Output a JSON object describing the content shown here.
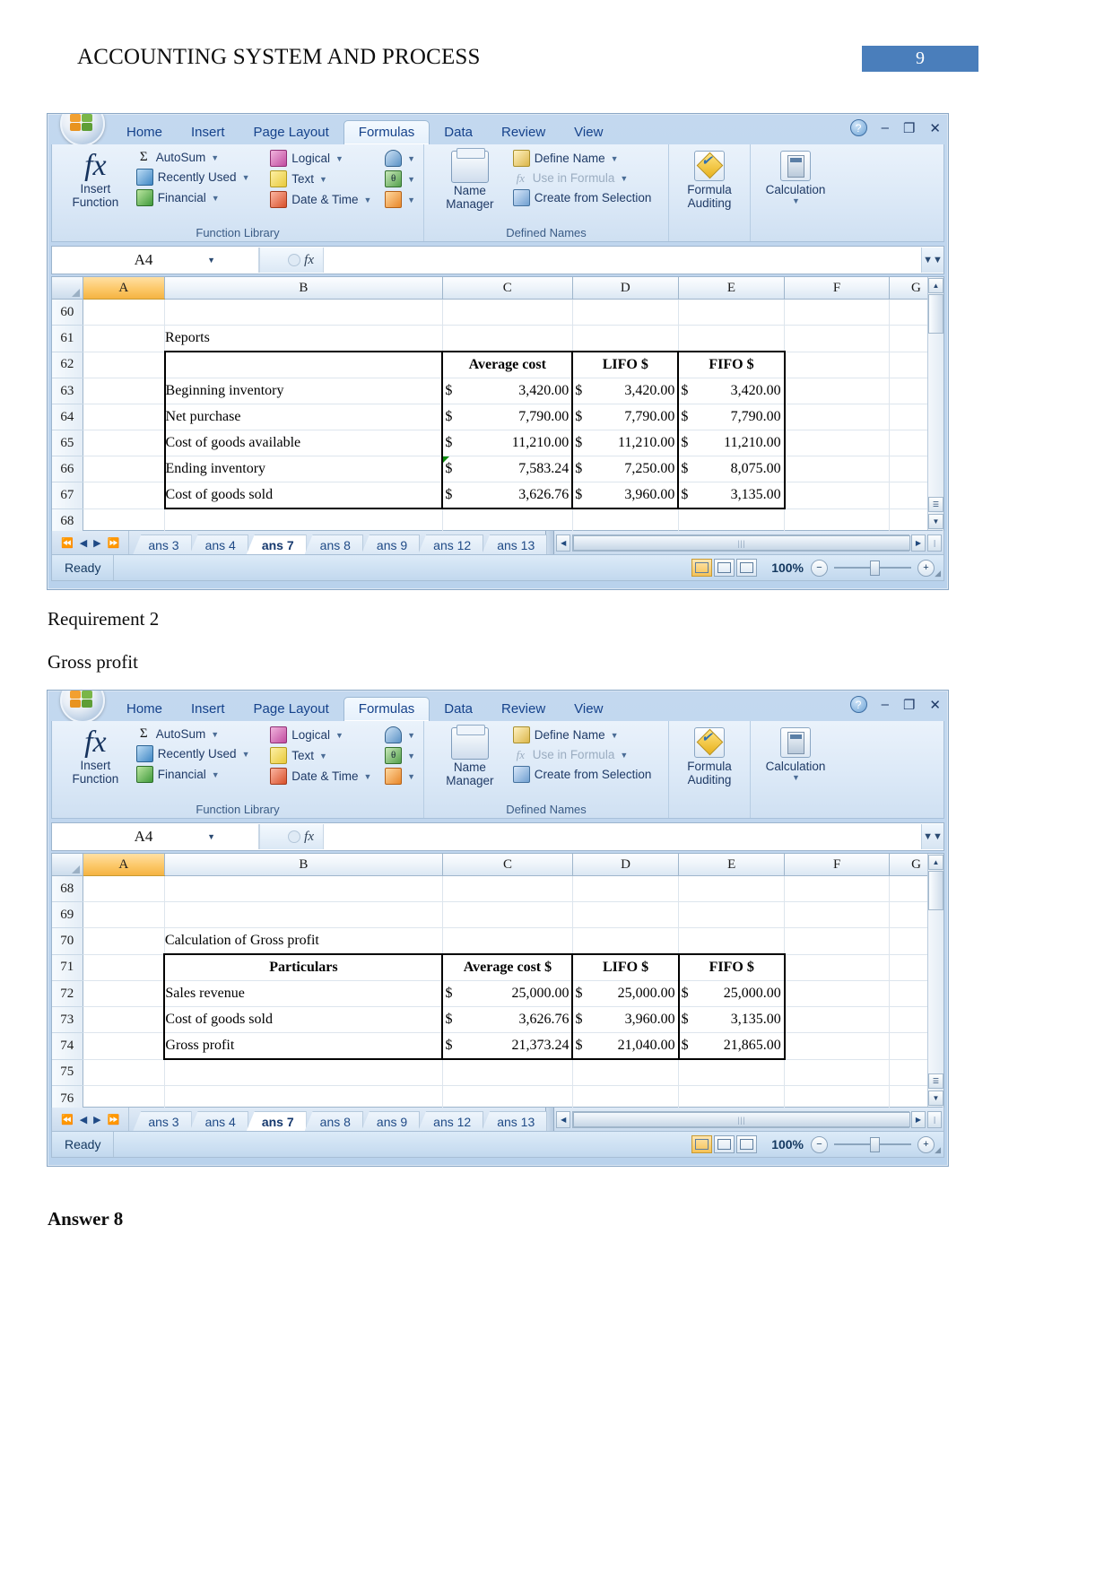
{
  "header": {
    "title": "ACCOUNTING SYSTEM AND PROCESS",
    "page_number": "9",
    "accent_color": "#4a7ebb"
  },
  "body_text": {
    "requirement_2": "Requirement 2",
    "gross_profit": "Gross profit",
    "answer_8": "Answer 8"
  },
  "excel": {
    "ribbon_tabs": [
      "Home",
      "Insert",
      "Page Layout",
      "Formulas",
      "Data",
      "Review",
      "View"
    ],
    "active_ribbon_tab": "Formulas",
    "window_controls": {
      "help": "?",
      "minimize": "–",
      "restore": "❐",
      "close": "✕"
    },
    "groups": {
      "function_library": {
        "label": "Function Library",
        "insert_function": "Insert Function",
        "items": [
          {
            "label": "AutoSum",
            "icon": "sigma-icon",
            "dropdown": true
          },
          {
            "label": "Recently Used",
            "icon": "recently-used-icon",
            "dropdown": true
          },
          {
            "label": "Financial",
            "icon": "financial-icon",
            "dropdown": true
          },
          {
            "label": "Logical",
            "icon": "logical-icon",
            "dropdown": true
          },
          {
            "label": "Text",
            "icon": "text-icon",
            "dropdown": true
          },
          {
            "label": "Date & Time",
            "icon": "date-time-icon",
            "dropdown": true
          }
        ],
        "extra_icons": [
          "lookup-reference-icon",
          "math-trig-icon",
          "more-functions-icon"
        ]
      },
      "defined_names": {
        "label": "Defined Names",
        "name_manager": "Name Manager",
        "items": [
          {
            "label": "Define Name",
            "icon": "define-name-icon",
            "dropdown": true,
            "disabled": false
          },
          {
            "label": "Use in Formula",
            "icon": "use-in-formula-icon",
            "dropdown": true,
            "disabled": true
          },
          {
            "label": "Create from Selection",
            "icon": "create-from-selection-icon",
            "dropdown": false,
            "disabled": false
          }
        ]
      },
      "formula_auditing": {
        "label": "Formula Auditing",
        "icon": "formula-auditing-icon"
      },
      "calculation": {
        "label": "Calculation",
        "icon": "calculation-icon"
      }
    },
    "formula_bar": {
      "name_box": "A4",
      "formula_value": "",
      "fx_label": "fx"
    },
    "columns": [
      "A",
      "B",
      "C",
      "D",
      "E",
      "F",
      "G"
    ],
    "selected_column": "A",
    "sheet_tabs": [
      "ans 3",
      "ans 4",
      "ans 7",
      "ans 8",
      "ans 9",
      "ans 12",
      "ans 13"
    ],
    "active_sheet_tab": "ans 7",
    "status": {
      "ready": "Ready",
      "zoom": "100%"
    }
  },
  "sheet1": {
    "row_numbers": [
      "60",
      "61",
      "62",
      "63",
      "64",
      "65",
      "66",
      "67",
      "68"
    ],
    "title_cell": "Reports",
    "headers": [
      "",
      "Average cost",
      "LIFO $",
      "FIFO $"
    ],
    "rows": [
      {
        "label": "Beginning inventory",
        "avg_sym": "$",
        "avg": "3,420.00",
        "lifo_sym": "$",
        "lifo": "3,420.00",
        "fifo_sym": "$",
        "fifo": "3,420.00"
      },
      {
        "label": "Net purchase",
        "avg_sym": "$",
        "avg": "7,790.00",
        "lifo_sym": "$",
        "lifo": "7,790.00",
        "fifo_sym": "$",
        "fifo": "7,790.00"
      },
      {
        "label": "Cost of goods available",
        "avg_sym": "$",
        "avg": "11,210.00",
        "lifo_sym": "$",
        "lifo": "11,210.00",
        "fifo_sym": "$",
        "fifo": "11,210.00"
      },
      {
        "label": "Ending inventory",
        "avg_sym": "$",
        "avg": "7,583.24",
        "lifo_sym": "$",
        "lifo": "7,250.00",
        "fifo_sym": "$",
        "fifo": "8,075.00"
      },
      {
        "label": "Cost of goods sold",
        "avg_sym": "$",
        "avg": "3,626.76",
        "lifo_sym": "$",
        "lifo": "3,960.00",
        "fifo_sym": "$",
        "fifo": "3,135.00"
      }
    ]
  },
  "sheet2": {
    "row_numbers": [
      "68",
      "69",
      "70",
      "71",
      "72",
      "73",
      "74",
      "75",
      "76"
    ],
    "title_cell": "Calculation of Gross profit",
    "headers": [
      "Particulars",
      "Average cost $",
      "LIFO $",
      "FIFO $"
    ],
    "rows": [
      {
        "label": "Sales revenue",
        "avg_sym": "$",
        "avg": "25,000.00",
        "lifo_sym": "$",
        "lifo": "25,000.00",
        "fifo_sym": "$",
        "fifo": "25,000.00"
      },
      {
        "label": "Cost of goods sold",
        "avg_sym": "$",
        "avg": "3,626.76",
        "lifo_sym": "$",
        "lifo": "3,960.00",
        "fifo_sym": "$",
        "fifo": "3,135.00"
      },
      {
        "label": "Gross profit",
        "avg_sym": "$",
        "avg": "21,373.24",
        "lifo_sym": "$",
        "lifo": "21,040.00",
        "fifo_sym": "$",
        "fifo": "21,865.00"
      }
    ]
  }
}
